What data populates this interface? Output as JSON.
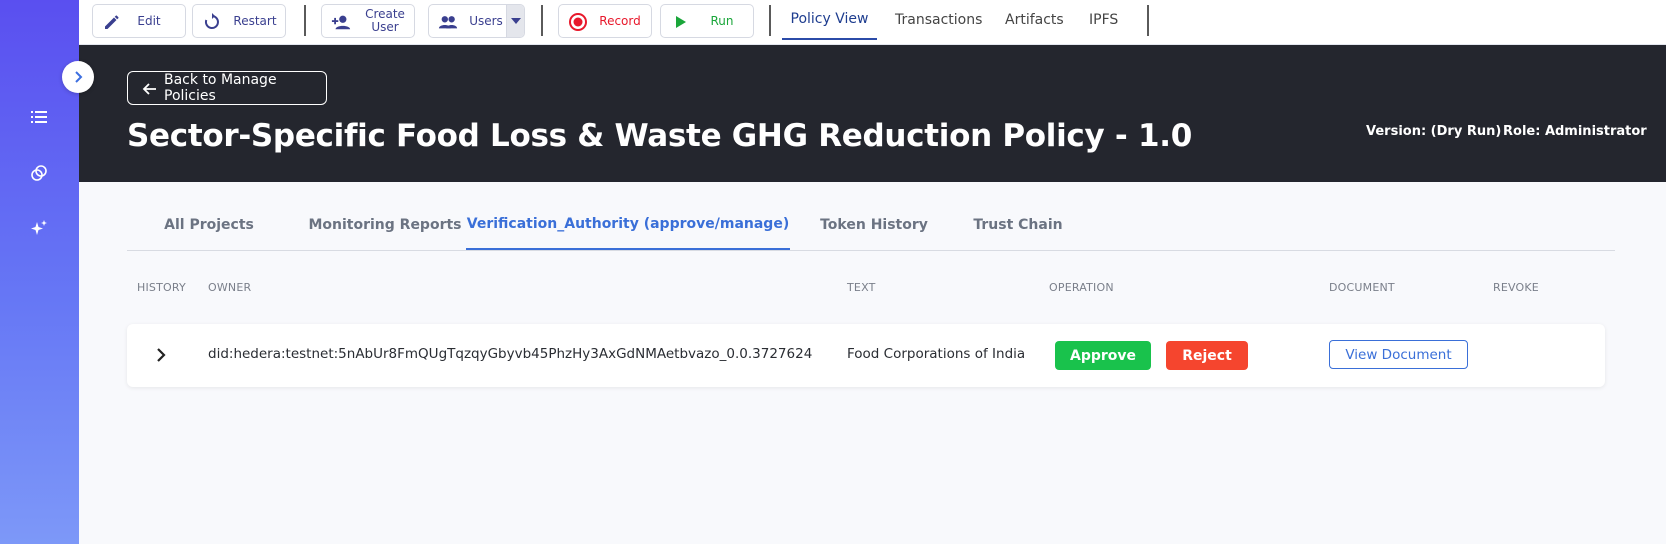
{
  "toolbar": {
    "edit": "Edit",
    "restart": "Restart",
    "create_user": "Create\nUser",
    "users": "Users",
    "record": "Record",
    "run": "Run",
    "nav_tabs": [
      "Policy View",
      "Transactions",
      "Artifacts",
      "IPFS"
    ]
  },
  "header": {
    "back": "Back to Manage Policies",
    "title": "Sector-Specific Food Loss & Waste GHG Reduction Policy - 1.0",
    "version": "Version: (Dry Run)",
    "role": "Role: Administrator"
  },
  "tabs": [
    "All Projects",
    "Monitoring Reports",
    "Verification_Authority (approve/manage)",
    "Token History",
    "Trust Chain"
  ],
  "table": {
    "columns": [
      "HISTORY",
      "OWNER",
      "TEXT",
      "OPERATION",
      "DOCUMENT",
      "REVOKE"
    ],
    "rows": [
      {
        "owner": "did:hedera:testnet:5nAbUr8FmQUgTqzqyGbyvb45PhzHy3AxGdNMAetbvazo_0.0.3727624",
        "text": "Food Corporations of India",
        "approve": "Approve",
        "reject": "Reject",
        "document": "View Document"
      }
    ]
  },
  "colors": {
    "sidebar_top": "#5a4ff0",
    "header_bg": "#24262e",
    "accent": "#3a6fd8",
    "approve": "#19c24c",
    "reject": "#f5452e",
    "record": "#e8182b",
    "run": "#1aa63a"
  }
}
